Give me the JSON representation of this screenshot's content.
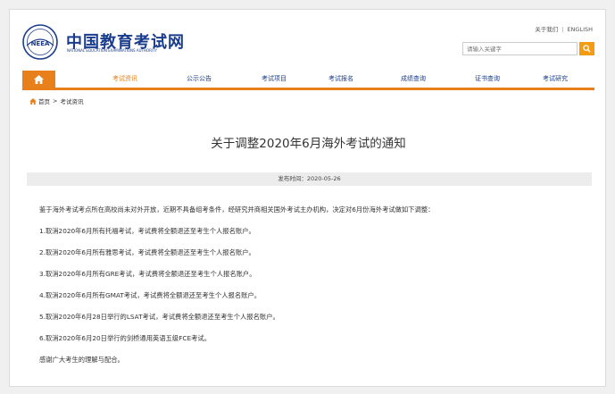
{
  "header": {
    "brand_cn": "中国教育考试网",
    "brand_en": "NATIONAL EDUCATION EXAMINATIONS AUTHORITY",
    "logo_text": "NEEA",
    "about": "关于我们",
    "english": "ENGLISH",
    "separator": "|"
  },
  "search": {
    "placeholder": "请输入关键字"
  },
  "nav": {
    "items": [
      "考试资讯",
      "公示公告",
      "考试项目",
      "考试报名",
      "成绩查询",
      "证书查询",
      "考试研究"
    ],
    "active_index": 0
  },
  "breadcrumb": {
    "home": "首页",
    "separator": ">",
    "current": "考试资讯"
  },
  "article": {
    "title": "关于调整2020年6月海外考试的通知",
    "pub_label": "发布时间：",
    "pub_date": "2020-05-26",
    "paragraphs": [
      "鉴于海外考试考点所在高校尚未对外开放，近期不具备组考条件，经研究并商相关国外考试主办机构，决定对6月份海外考试做如下调整：",
      "1.取消2020年6月所有托福考试，考试费将全额退还至考生个人报名账户。",
      "2.取消2020年6月所有雅思考试，考试费将全额退还至考生个人报名账户。",
      "3.取消2020年6月所有GRE考试，考试费将全额退还至考生个人报名账户。",
      "4.取消2020年6月所有GMAT考试，考试费将全额退还至考生个人报名账户。",
      "5.取消2020年6月28日举行的LSAT考试，考试费将全额退还至考生个人报名账户。",
      "6.取消2020年6月20日举行的剑桥通用英语五级FCE考试。",
      "感谢广大考生的理解与配合。"
    ]
  },
  "colors": {
    "accent": "#e77f1a",
    "brand_blue": "#1a3c8c",
    "search_button": "#f39c12"
  },
  "icons": {
    "home": "home-icon",
    "search": "search-icon",
    "logo": "neea-logo"
  }
}
